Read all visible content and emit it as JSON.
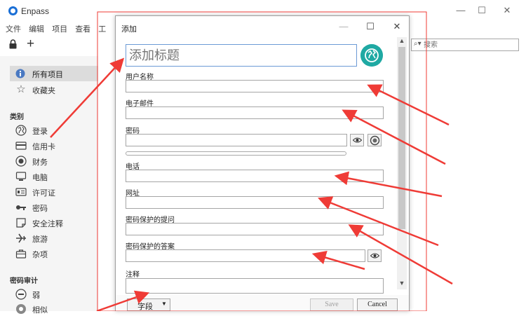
{
  "app": {
    "title": "Enpass",
    "window_controls": [
      "—",
      "☐",
      "✕"
    ]
  },
  "menu": [
    "文件",
    "编辑",
    "项目",
    "查看",
    "工"
  ],
  "search": {
    "placeholder": "搜索"
  },
  "sidebar": {
    "all_items": "所有项目",
    "favorites": "收藏夹",
    "categories_header": "类别",
    "categories": [
      {
        "label": "登录",
        "icon": "globe-icon"
      },
      {
        "label": "信用卡",
        "icon": "credit-card-icon"
      },
      {
        "label": "财务",
        "icon": "finance-icon"
      },
      {
        "label": "电脑",
        "icon": "computer-icon"
      },
      {
        "label": "许可证",
        "icon": "license-icon"
      },
      {
        "label": "密码",
        "icon": "key-icon"
      },
      {
        "label": "安全注释",
        "icon": "note-icon"
      },
      {
        "label": "旅游",
        "icon": "airplane-icon"
      },
      {
        "label": "杂项",
        "icon": "briefcase-icon"
      }
    ],
    "audit_header": "密码审计",
    "audit": [
      {
        "label": "弱",
        "icon": "minus-circle-icon"
      },
      {
        "label": "相似",
        "icon": "similar-icon"
      }
    ]
  },
  "dialog": {
    "title": "添加",
    "controls": [
      "—",
      "☐",
      "✕"
    ],
    "title_placeholder": "添加标题",
    "fields": {
      "username": "用户名称",
      "email": "电子邮件",
      "password": "密码",
      "phone": "电话",
      "url": "网址",
      "security_question": "密码保护的提问",
      "security_answer": "密码保护的答案",
      "notes": "注释"
    },
    "footer": {
      "field_button": "字段",
      "save": "Save",
      "cancel": "Cancel"
    }
  },
  "colors": {
    "accent": "#1a6fd6",
    "globe_button": "#1fa9a3",
    "annotation": "#ef3b36"
  }
}
